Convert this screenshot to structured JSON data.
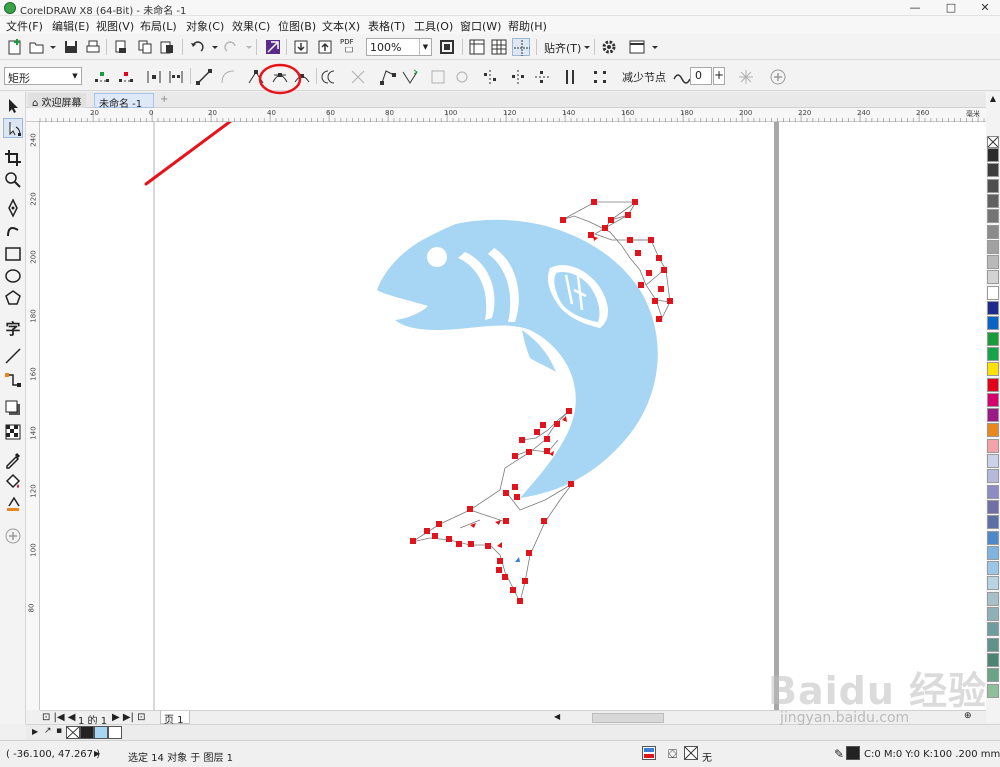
{
  "window": {
    "title": "CorelDRAW X8 (64-Bit) - 未命名 -1",
    "controls": [
      "—",
      "□",
      "✕"
    ]
  },
  "menu": [
    "文件(F)",
    "编辑(E)",
    "视图(V)",
    "布局(L)",
    "对象(C)",
    "效果(C)",
    "位图(B)",
    "文本(X)",
    "表格(T)",
    "工具(O)",
    "窗口(W)",
    "帮助(H)"
  ],
  "toolbar": {
    "zoom": "100%",
    "snap_label": "贴齐(T)",
    "pdf_label": "PDF"
  },
  "property_bar": {
    "shape_type": "矩形",
    "reduce_nodes_label": "减少节点",
    "smoothness_value": "0",
    "plus_label": "+"
  },
  "tabs": {
    "welcome": "欢迎屏幕",
    "document": "未命名 -1",
    "add": "+"
  },
  "ruler": {
    "h_labels": [
      "20",
      "0",
      "20",
      "40",
      "60",
      "80",
      "100",
      "120",
      "140",
      "160",
      "180",
      "200",
      "220",
      "240",
      "260"
    ],
    "unit": "毫米",
    "v_labels": [
      "240",
      "220",
      "200",
      "180",
      "160",
      "140",
      "120",
      "100",
      "80"
    ]
  },
  "page_nav": {
    "page_indicator": "1 的 1",
    "page_tab": "页 1"
  },
  "status": {
    "coords": "( -36.100, 47.267 )",
    "selection": "选定 14 对象 于 图层 1",
    "fill_none": "无",
    "outline": "C:0 M:0 Y:0 K:100  .200 mm"
  },
  "watermark": {
    "brand": "Baidu 经验",
    "url": "jingyan.baidu.com"
  },
  "colors": {
    "fish": "#a6d6f3",
    "node": "#e0141c",
    "annotation": "#e8121b",
    "palette": [
      "#2b2b2b",
      "#3d3d3d",
      "#4e4e4e",
      "#606060",
      "#747474",
      "#8a8a8a",
      "#a1a1a1",
      "#b9b9b9",
      "#d3d3d3",
      "#ffffff",
      "#1d2b8c",
      "#0a63c6",
      "#1a9b3a",
      "#17a34a",
      "#ffe100",
      "#e3001b",
      "#d4006f",
      "#9a1b86",
      "#e8871e",
      "#f3a3a8",
      "#ccd3e8",
      "#b7b9dc",
      "#8c8bc3",
      "#6f6fa6",
      "#5a6fa3",
      "#4f88c9",
      "#7fb4e0",
      "#9cc6e5",
      "#b8d4e3",
      "#a8c0c8",
      "#8fb0b5",
      "#6f9d9e",
      "#5f9288",
      "#4c8474",
      "#6aa386",
      "#8ebf9a"
    ]
  }
}
